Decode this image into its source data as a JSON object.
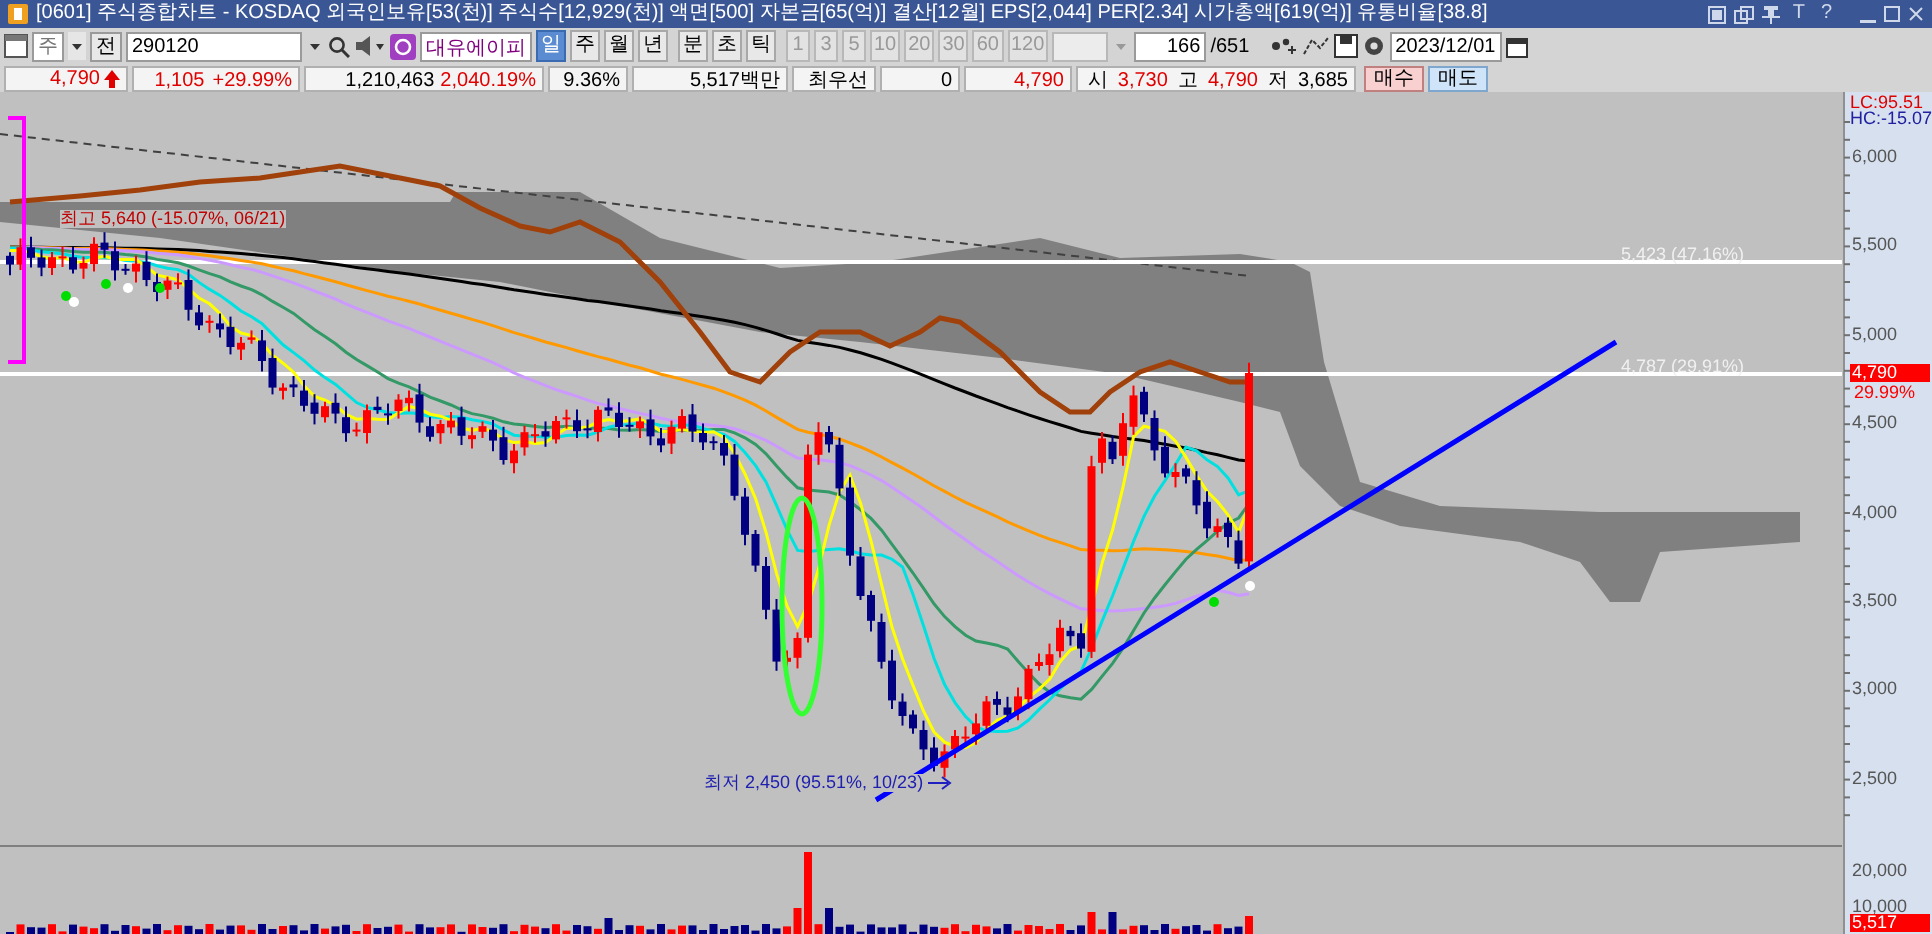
{
  "title_bar": {
    "title": "[0601] 주식종합차트 - KOSDAQ 외국인보유[53(천)] 주식수[12,929(천)] 액면[500] 자본금[65(억)] 결산[12월] EPS[2,044] PER[2.34] 시가총액[619(억)] 유통비율[38.8]",
    "buttons": [
      "T",
      "?"
    ]
  },
  "toolbar": {
    "market": "주",
    "mode": "전",
    "code": "290120",
    "stock_name": "대유에이피",
    "periods": [
      {
        "label": "일",
        "selected": true
      },
      {
        "label": "주",
        "selected": false
      },
      {
        "label": "월",
        "selected": false
      },
      {
        "label": "년",
        "selected": false
      },
      {
        "label": "분",
        "selected": false
      },
      {
        "label": "초",
        "selected": false
      },
      {
        "label": "틱",
        "selected": false
      }
    ],
    "intervals": [
      "1",
      "3",
      "5",
      "10",
      "20",
      "30",
      "60",
      "120"
    ],
    "count": "166",
    "total": "/651",
    "date": "2023/12/01"
  },
  "quote": {
    "price": "4,790",
    "change": "1,105",
    "change_rate": "+29.99%",
    "volume": "1,210,463",
    "volume_rate": "2,040.19%",
    "turnover": "9.36%",
    "amount": "5,517백만",
    "best_label": "최우선",
    "best_qty": "0",
    "best_price": "4,790",
    "open_label": "시",
    "open": "3,730",
    "high_label": "고",
    "high": "4,790",
    "low_label": "저",
    "low": "3,685",
    "buy": "매수",
    "sell": "매도"
  },
  "chart": {
    "legend": [
      "LC:95.51",
      "HC:-15.07"
    ],
    "price_axis": [
      "6,000",
      "5,500",
      "5,000",
      "4,500",
      "4,000",
      "3,500",
      "3,000",
      "2,500"
    ],
    "price_tag": {
      "value": "4,790",
      "rate": "29.99%"
    },
    "levels": [
      "5,423 (47.16%)",
      "4,787 (29.91%)"
    ],
    "annotations": [
      {
        "kind": "high",
        "text": "최고 5,640 (-15.07%, 06/21)"
      },
      {
        "kind": "low",
        "text": "최저 2,450 (95.51%, 10/23)"
      }
    ],
    "volume_axis": [
      "20,000",
      "10,000"
    ],
    "volume_tag": "5,517"
  }
}
